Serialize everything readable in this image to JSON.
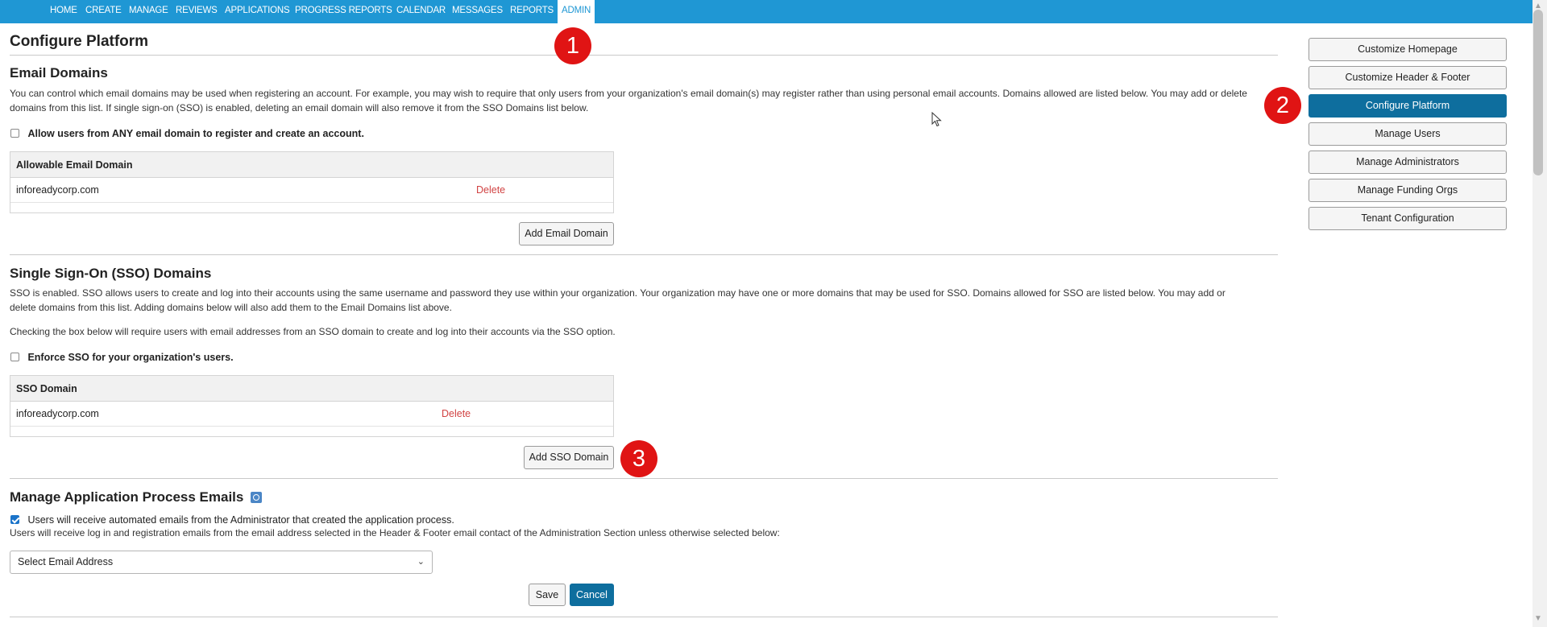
{
  "nav": {
    "items": [
      "HOME",
      "CREATE",
      "MANAGE",
      "REVIEWS",
      "APPLICATIONS",
      "PROGRESS REPORTS",
      "CALENDAR",
      "MESSAGES",
      "REPORTS",
      "ADMIN"
    ],
    "active": "ADMIN"
  },
  "page": {
    "title": "Configure Platform"
  },
  "email_domains": {
    "heading": "Email Domains",
    "description": "You can control which email domains may be used when registering an account. For example, you may wish to require that only users from your organization's email domain(s) may register rather than using personal email accounts. Domains allowed are listed below. You may add or delete domains from this list. If single sign-on (SSO) is enabled, deleting an email domain will also remove it from the SSO Domains list below.",
    "allow_any_label": "Allow users from ANY email domain to register and create an account.",
    "allow_any_checked": false,
    "table_header": "Allowable Email Domain",
    "rows": [
      {
        "domain": "inforeadycorp.com",
        "action": "Delete"
      }
    ],
    "add_button": "Add Email Domain"
  },
  "sso_domains": {
    "heading": "Single Sign-On (SSO) Domains",
    "description": "SSO is enabled. SSO allows users to create and log into their accounts using the same username and password they use within your organization. Your organization may have one or more domains that may be used for SSO. Domains allowed for SSO are listed below. You may add or delete domains from this list. Adding domains below will also add them to the Email Domains list above.",
    "note": "Checking the box below will require users with email addresses from an SSO domain to create and log into their accounts via the SSO option.",
    "enforce_label": "Enforce SSO for your organization's users.",
    "enforce_checked": false,
    "table_header": "SSO Domain",
    "rows": [
      {
        "domain": "inforeadycorp.com",
        "action": "Delete"
      }
    ],
    "add_button": "Add SSO Domain"
  },
  "process_emails": {
    "heading": "Manage Application Process Emails",
    "info_icon": "info-icon",
    "auto_label": "Users will receive automated emails from the Administrator that created the application process.",
    "auto_checked": true,
    "note": "Users will receive log in and registration emails from the email address selected in the Header & Footer email contact of the Administration Section unless otherwise selected below:",
    "select_value": "Select Email Address",
    "save": "Save",
    "cancel": "Cancel"
  },
  "sidebar": {
    "items": [
      "Customize Homepage",
      "Customize Header & Footer",
      "Configure Platform",
      "Manage Users",
      "Manage Administrators",
      "Manage Funding Orgs",
      "Tenant Configuration"
    ],
    "active": "Configure Platform"
  },
  "markers": [
    "1",
    "2",
    "3"
  ],
  "colors": {
    "nav": "#1f97d4",
    "primary_button": "#0e6e9e",
    "delete_link": "#d14343",
    "marker": "#e01414"
  }
}
